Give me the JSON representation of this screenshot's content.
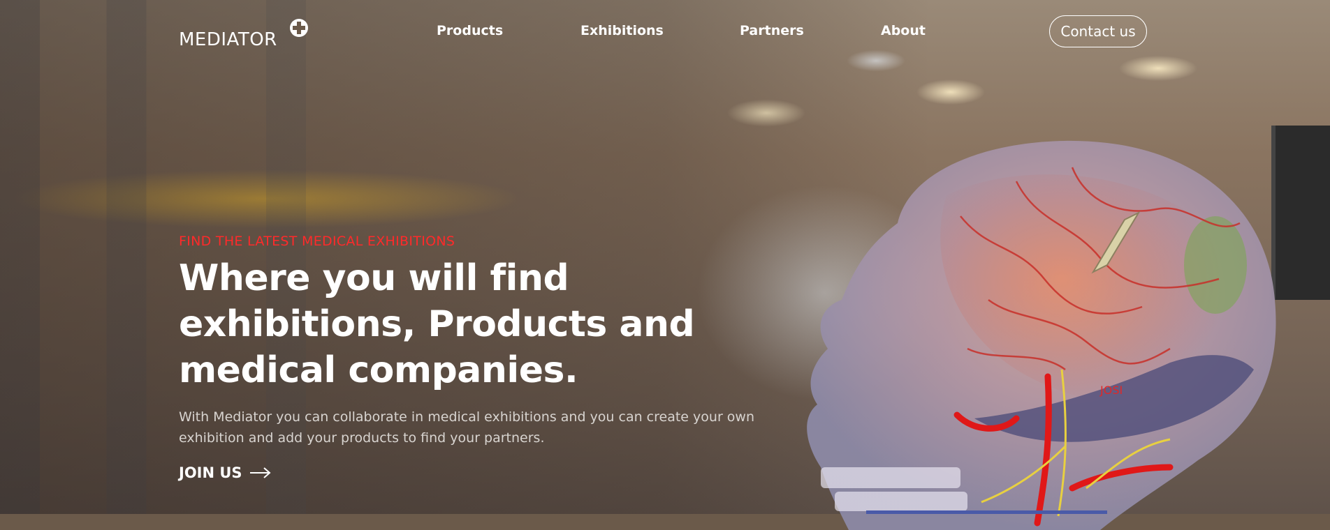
{
  "brand": {
    "name": "MEDIATOR",
    "logo_icon": "plus-circle-icon"
  },
  "nav": {
    "items": [
      {
        "label": "Products"
      },
      {
        "label": "Exhibitions"
      },
      {
        "label": "Partners"
      },
      {
        "label": "About"
      }
    ],
    "contact_label": "Contact us"
  },
  "hero": {
    "eyebrow": "FIND THE LATEST MEDICAL EXHIBITIONS",
    "headline": "Where you will find exhibitions, Products and medical companies.",
    "subtext": "With Mediator you can collaborate in medical exhibitions and you can create your own exhibition and add your products to find your partners.",
    "cta_label": "JOIN US",
    "cta_icon": "arrow-right-icon",
    "image_label": "JOSI"
  },
  "colors": {
    "accent_red": "#ff2a2a",
    "text_white": "#ffffff",
    "bar_blue": "#4a5aa8"
  }
}
